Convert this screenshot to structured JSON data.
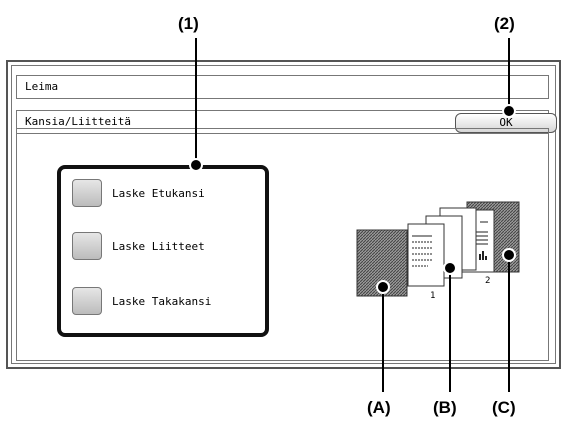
{
  "callouts": {
    "c1": "(1)",
    "c2": "(2)",
    "cA": "(A)",
    "cB": "(B)",
    "cC": "(C)"
  },
  "header": {
    "title": "Leima"
  },
  "subheader": {
    "title": "Kansia/Liitteitä"
  },
  "buttons": {
    "ok_label": "OK"
  },
  "options": [
    {
      "label": "Laske Etukansi",
      "checked": false
    },
    {
      "label": "Laske Liitteet",
      "checked": false
    },
    {
      "label": "Laske Takakansi",
      "checked": false
    }
  ],
  "illustration": {
    "page_numbers": [
      "1",
      "2"
    ]
  }
}
